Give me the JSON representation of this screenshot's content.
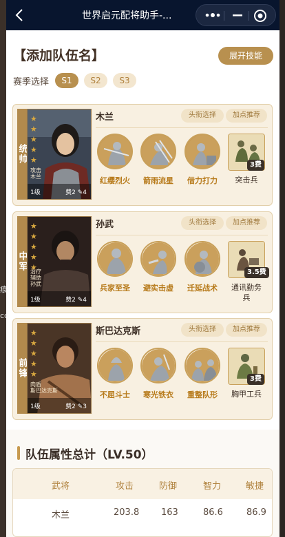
{
  "titlebar": {
    "title": "世界启元配将助手-...",
    "back_icon": "chevron-left-icon",
    "more_icon": "more-dots-icon",
    "min_icon": "minimize-icon",
    "close_icon": "target-close-icon"
  },
  "team": {
    "title": "【添加队伍名】",
    "expand_label": "展开技能"
  },
  "season": {
    "label": "赛季选择",
    "options": [
      "S1",
      "S2",
      "S3"
    ],
    "selected": "S1"
  },
  "heroes": [
    {
      "role": "统帅",
      "name": "木兰",
      "stars": 5,
      "meta": [
        "攻击",
        "木兰"
      ],
      "level": "1级",
      "cost": "费2",
      "points": "4",
      "title_btn": "头衔选择",
      "point_btn": "加点推荐",
      "skills": [
        "红缨烈火",
        "箭雨流星",
        "借力打力"
      ],
      "troop": {
        "name": "突击兵",
        "cost": "3费"
      }
    },
    {
      "role": "中军",
      "name": "孙武",
      "stars": 5,
      "meta": [
        "治疗",
        "辅助",
        "孙武"
      ],
      "level": "1级",
      "cost": "费2",
      "points": "4",
      "title_btn": "头衔选择",
      "point_btn": "加点推荐",
      "skills": [
        "兵家至圣",
        "避实击虚",
        "迁延战术"
      ],
      "troop": {
        "name": "通讯勤务兵",
        "cost": "3.5费"
      }
    },
    {
      "role": "前锋",
      "name": "斯巴达克斯",
      "stars": 5,
      "meta": [
        "肉盾",
        "斯巴达克斯"
      ],
      "level": "1级",
      "cost": "费2",
      "points": "3",
      "title_btn": "头衔选择",
      "point_btn": "加点推荐",
      "skills": [
        "不屈斗士",
        "寒光铁衣",
        "重整队形"
      ],
      "troop": {
        "name": "胸甲工兵",
        "cost": "3费"
      }
    }
  ],
  "stats": {
    "title": "队伍属性总计（LV.50）",
    "headers": [
      "武将",
      "攻击",
      "防御",
      "智力",
      "敏捷"
    ],
    "rows": [
      [
        "木兰",
        "203.8",
        "163",
        "86.6",
        "86.9"
      ]
    ]
  },
  "colors": {
    "accent": "#b8904f",
    "navbar": "#08152e",
    "skill_text": "#b77a1a"
  }
}
